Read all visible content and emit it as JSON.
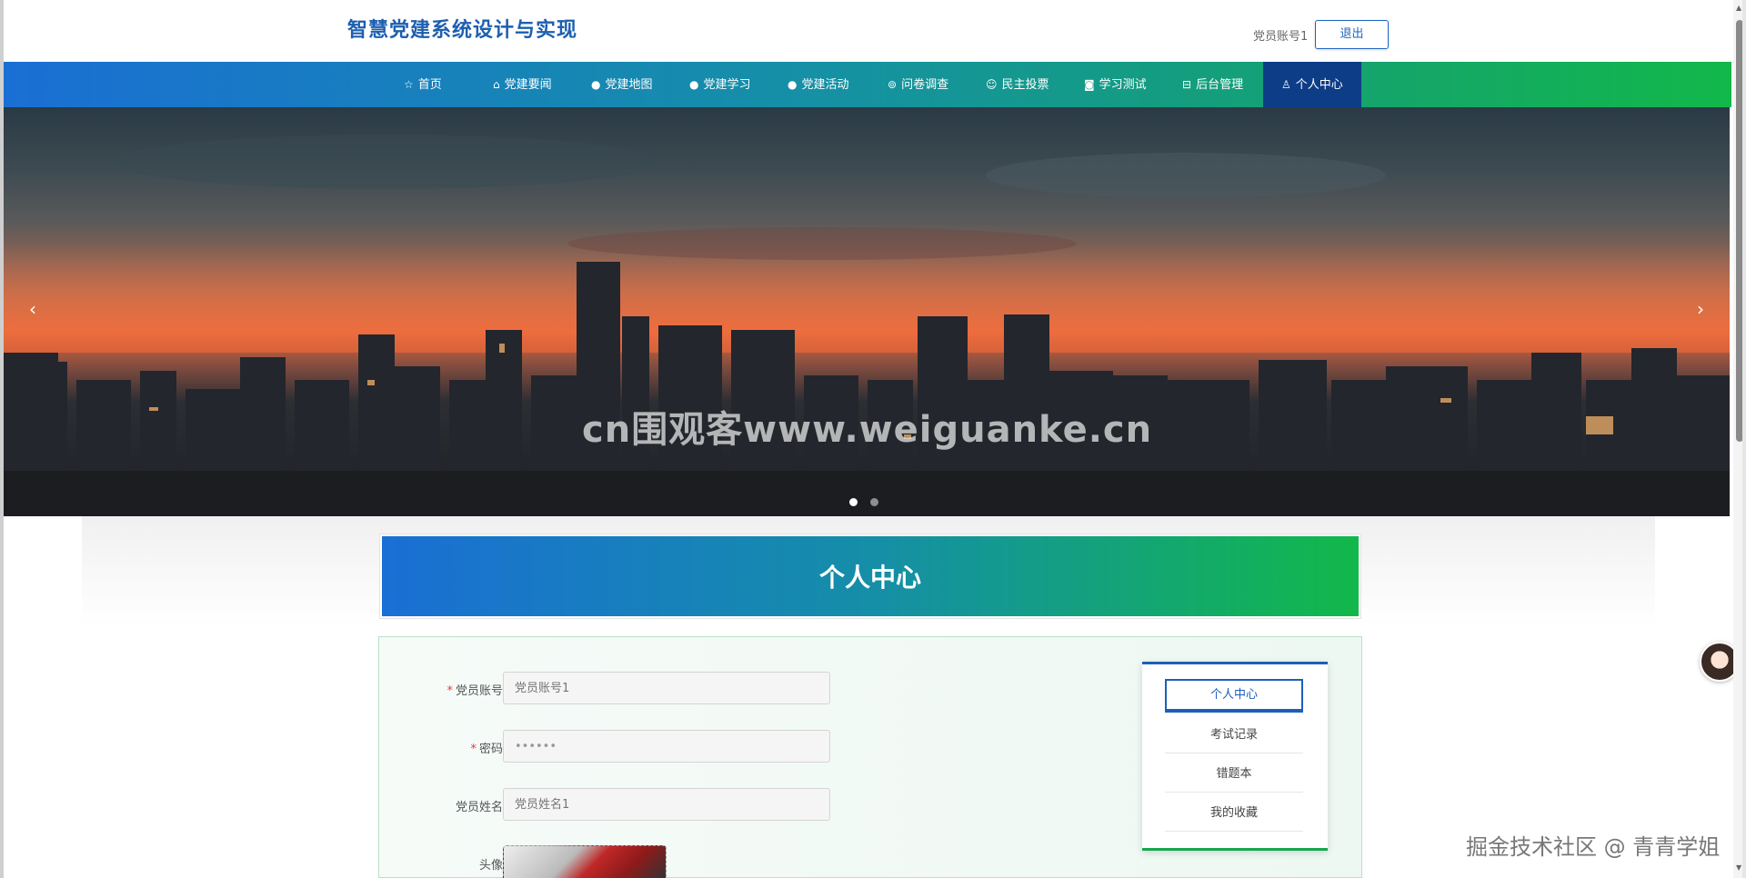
{
  "header": {
    "site_title": "智慧党建系统设计与实现",
    "account_name": "党员账号1",
    "logout_label": "退出"
  },
  "nav": {
    "items": [
      {
        "label": "首页",
        "icon": "star-icon"
      },
      {
        "label": "党建要闻",
        "icon": "bag-icon"
      },
      {
        "label": "党建地图",
        "icon": "info-icon"
      },
      {
        "label": "党建学习",
        "icon": "question-icon"
      },
      {
        "label": "党建活动",
        "icon": "info-icon"
      },
      {
        "label": "问卷调查",
        "icon": "settings-icon"
      },
      {
        "label": "民主投票",
        "icon": "smile-icon"
      },
      {
        "label": "学习测试",
        "icon": "camera-icon"
      },
      {
        "label": "后台管理",
        "icon": "gift-icon"
      },
      {
        "label": "个人中心",
        "icon": "user-icon"
      }
    ],
    "active_index": 9
  },
  "banner": {
    "watermark": "cn围观客www.weiguanke.cn",
    "prev_arrow": "‹",
    "next_arrow": "›",
    "slide_count": 2,
    "current_slide": 1
  },
  "section": {
    "title": "个人中心"
  },
  "form": {
    "account_label": "党员账号",
    "account_placeholder": "党员账号1",
    "password_label": "密码",
    "password_value": "••••••",
    "name_label": "党员姓名",
    "name_placeholder": "党员姓名1",
    "avatar_label": "头像",
    "required_mark": "*"
  },
  "side_menu": {
    "active": "个人中心",
    "items": [
      "考试记录",
      "错题本",
      "我的收藏"
    ]
  },
  "corner_watermark": "掘金技术社区 @ 青青学姐",
  "colors": {
    "brand_blue": "#1d5fb0",
    "nav_start": "#1a6fd4",
    "nav_end": "#12b84a",
    "nav_active": "#0d3d86"
  }
}
